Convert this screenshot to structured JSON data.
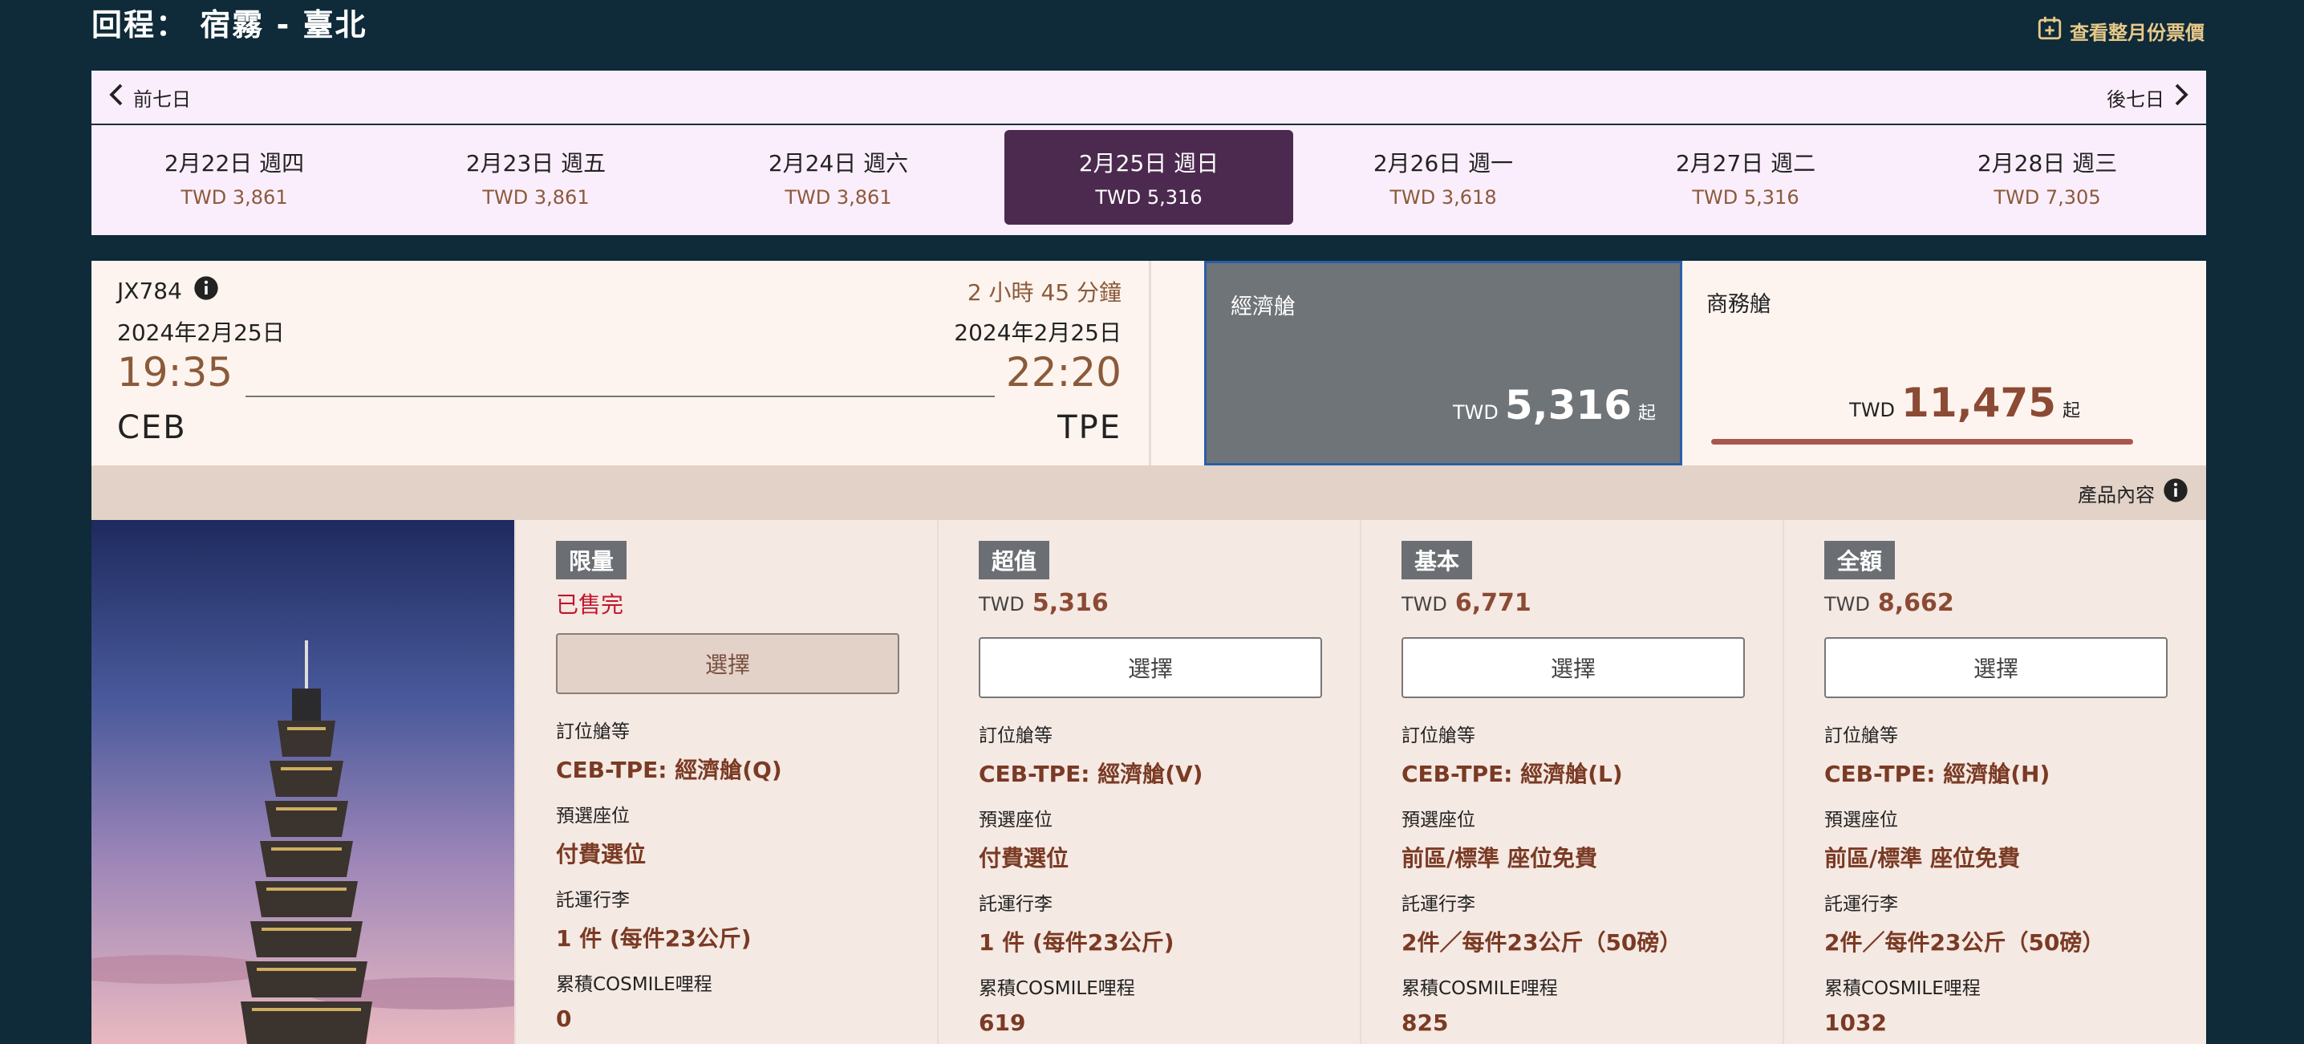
{
  "header": {
    "title": "回程： 宿霧 - 臺北",
    "month_link": "查看整月份票價"
  },
  "week_nav": {
    "prev": "前七日",
    "next": "後七日"
  },
  "days": [
    {
      "label": "2月22日 週四",
      "price": "TWD 3,861"
    },
    {
      "label": "2月23日 週五",
      "price": "TWD 3,861"
    },
    {
      "label": "2月24日 週六",
      "price": "TWD 3,861"
    },
    {
      "label": "2月25日 週日",
      "price": "TWD 5,316",
      "selected": true
    },
    {
      "label": "2月26日 週一",
      "price": "TWD 3,618"
    },
    {
      "label": "2月27日 週二",
      "price": "TWD 5,316"
    },
    {
      "label": "2月28日 週三",
      "price": "TWD 7,305"
    }
  ],
  "flight": {
    "number": "JX784",
    "duration": "2 小時 45 分鐘",
    "dep_date": "2024年2月25日",
    "arr_date": "2024年2月25日",
    "dep_time": "19:35",
    "arr_time": "22:20",
    "dep_code": "CEB",
    "arr_code": "TPE"
  },
  "cabins": {
    "economy": {
      "name": "經濟艙",
      "currency": "TWD",
      "price": "5,316",
      "suffix": "起"
    },
    "business": {
      "name": "商務艙",
      "currency": "TWD",
      "price": "11,475",
      "suffix": "起"
    }
  },
  "product_info": "產品內容",
  "fares": [
    {
      "badge": "限量",
      "sold_out": "已售完",
      "select": "選擇",
      "class_label": "訂位艙等",
      "class_val": "CEB-TPE: 經濟艙(Q)",
      "seat_label": "預選座位",
      "seat_val": "付費選位",
      "bag_label": "託運行李",
      "bag_val": "1 件 (每件23公斤)",
      "miles_label": "累積COSMILE哩程",
      "miles_val": "0"
    },
    {
      "badge": "超值",
      "currency": "TWD",
      "price": "5,316",
      "select": "選擇",
      "class_label": "訂位艙等",
      "class_val": "CEB-TPE: 經濟艙(V)",
      "seat_label": "預選座位",
      "seat_val": "付費選位",
      "bag_label": "託運行李",
      "bag_val": "1 件 (每件23公斤)",
      "miles_label": "累積COSMILE哩程",
      "miles_val": "619"
    },
    {
      "badge": "基本",
      "currency": "TWD",
      "price": "6,771",
      "select": "選擇",
      "class_label": "訂位艙等",
      "class_val": "CEB-TPE: 經濟艙(L)",
      "seat_label": "預選座位",
      "seat_val": "前區/標準 座位免費",
      "bag_label": "託運行李",
      "bag_val": "2件／每件23公斤（50磅）",
      "miles_label": "累積COSMILE哩程",
      "miles_val": "825"
    },
    {
      "badge": "全額",
      "currency": "TWD",
      "price": "8,662",
      "select": "選擇",
      "class_label": "訂位艙等",
      "class_val": "CEB-TPE: 經濟艙(H)",
      "seat_label": "預選座位",
      "seat_val": "前區/標準 座位免費",
      "bag_label": "託運行李",
      "bag_val": "2件／每件23公斤（50磅）",
      "miles_label": "累積COSMILE哩程",
      "miles_val": "1032"
    }
  ],
  "colors": {
    "background": "#0f2a38",
    "accent": "#4c2a4f",
    "price_brown": "#8b4a34",
    "sold_out_red": "#c0162d"
  }
}
